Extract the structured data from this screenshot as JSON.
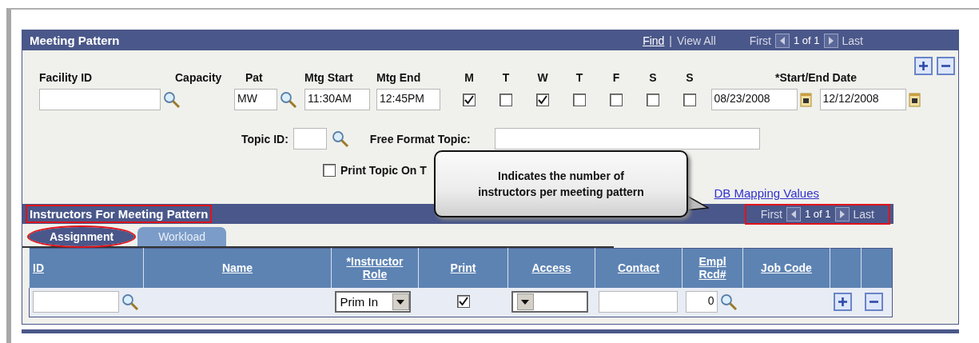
{
  "meeting_pattern": {
    "title": "Meeting Pattern",
    "nav": {
      "find": "Find",
      "separator": "|",
      "view_all": "View All",
      "first": "First",
      "count": "1 of 1",
      "last": "Last"
    },
    "facility_label": "Facility ID",
    "capacity_label": "Capacity",
    "pat_label": "Pat",
    "pat_value": "MW",
    "start_label": "Mtg Start",
    "start_value": "11:30AM",
    "end_label": "Mtg End",
    "end_value": "12:45PM",
    "days": [
      {
        "label": "M",
        "checked": true
      },
      {
        "label": "T",
        "checked": false
      },
      {
        "label": "W",
        "checked": true
      },
      {
        "label": "T",
        "checked": false
      },
      {
        "label": "F",
        "checked": false
      },
      {
        "label": "S",
        "checked": false
      },
      {
        "label": "S",
        "checked": false
      }
    ],
    "date_label": "*Start/End Date",
    "start_date": "08/23/2008",
    "end_date": "12/12/2008",
    "topic_id_label": "Topic ID:",
    "free_topic_label": "Free Format Topic:",
    "print_topic": {
      "label": "Print Topic On T",
      "checked": false
    },
    "db_link": "DB Mapping Values"
  },
  "instructors": {
    "title": "Instructors For Meeting Pattern",
    "pager": {
      "first": "First",
      "count": "1 of 1",
      "last": "Last"
    },
    "tabs": [
      {
        "label": "Assignment",
        "selected": true
      },
      {
        "label": "Workload",
        "selected": false
      }
    ],
    "columns": [
      "ID",
      "Name",
      "*Instructor Role",
      "Print",
      "Access",
      "Contact",
      "Empl Rcd#",
      "Job Code"
    ],
    "rows": [
      {
        "role": "Prim In",
        "print": true,
        "empl_rcd": "0"
      }
    ]
  },
  "callout": {
    "text": "Indicates the number of instructors per meeting pattern"
  }
}
